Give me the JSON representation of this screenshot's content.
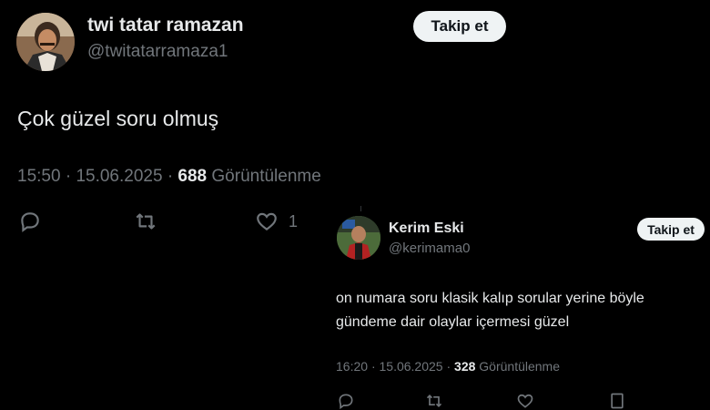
{
  "main_tweet": {
    "author": {
      "name": "twi tatar ramazan",
      "handle": "@twitatarramaza1",
      "avatar_icon": "user-avatar-man-mustache"
    },
    "follow_label": "Takip et",
    "text": "Çok güzel soru olmuş",
    "time": "15:50",
    "separator": "·",
    "date": "15.06.2025",
    "views_count": "688",
    "views_label": "Görüntülenme",
    "actions": {
      "reply_icon": "reply-icon",
      "retweet_icon": "retweet-icon",
      "like_icon": "heart-icon",
      "like_count": "1"
    }
  },
  "reply_tweet": {
    "author": {
      "name": "Kerim Eski",
      "handle": "@kerimama0",
      "avatar_icon": "user-avatar-man-red"
    },
    "follow_label": "Takip et",
    "text_lines": [
      "on numara soru klasik kalıp sorular yerine böyle",
      "gündeme dair olaylar içermesi güzel"
    ],
    "time": "16:20",
    "separator": "·",
    "date": "15.06.2025",
    "views_count": "328",
    "views_label": "Görüntülenme"
  },
  "colors": {
    "background": "#000000",
    "text": "#e7e9ea",
    "muted": "#71767b",
    "button_bg": "#eff3f4",
    "button_text": "#0f1419"
  }
}
